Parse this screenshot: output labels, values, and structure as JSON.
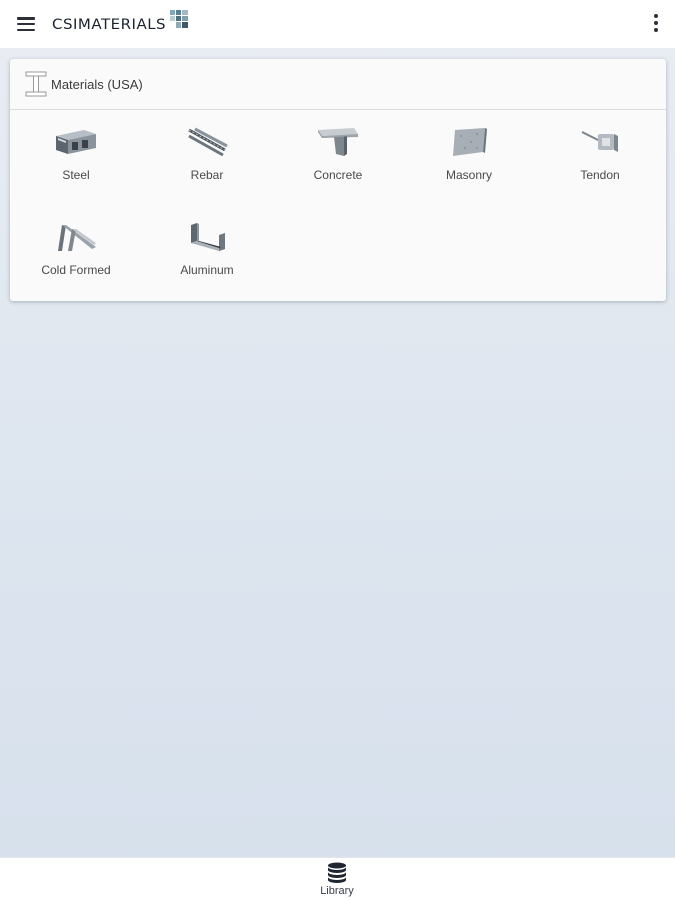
{
  "app": {
    "logo_text": "CSIMATERIALS",
    "menu_icon": "hamburger-menu-icon",
    "overflow_icon": "more-vert-icon"
  },
  "library": {
    "title": "Materials (USA)",
    "icon": "i-beam-icon",
    "materials": [
      {
        "label": "Steel",
        "icon": "steel-icon"
      },
      {
        "label": "Rebar",
        "icon": "rebar-icon"
      },
      {
        "label": "Concrete",
        "icon": "concrete-icon"
      },
      {
        "label": "Masonry",
        "icon": "masonry-icon"
      },
      {
        "label": "Tendon",
        "icon": "tendon-icon"
      },
      {
        "label": "Cold Formed",
        "icon": "cold-formed-icon"
      },
      {
        "label": "Aluminum",
        "icon": "aluminum-icon"
      }
    ]
  },
  "bottom_nav": {
    "items": [
      {
        "label": "Library",
        "icon": "database-icon"
      }
    ]
  },
  "colors": {
    "accent_dark": "#2a2f38",
    "background_top": "#e9edf3",
    "background_bottom": "#d6e0ec"
  }
}
